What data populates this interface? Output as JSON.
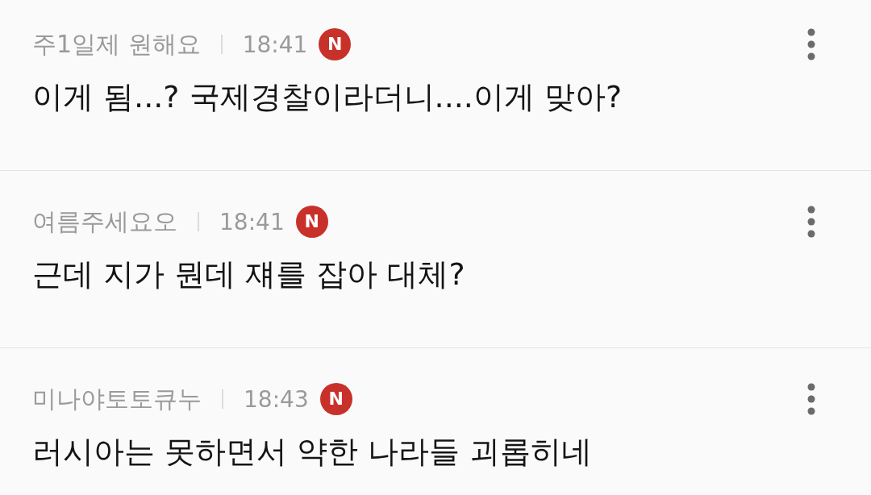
{
  "comments": [
    {
      "author": "주1일제 원해요",
      "time": "18:41",
      "badge": "N",
      "text": "이게 됨...? 국제경찰이라더니....이게 맞아?"
    },
    {
      "author": "여름주세요오",
      "time": "18:41",
      "badge": "N",
      "text": "근데 지가 뭔데 쟤를 잡아 대체?"
    },
    {
      "author": "미나야토토큐누",
      "time": "18:43",
      "badge": "N",
      "text": "러시아는 못하면서 약한 나라들 괴롭히네"
    }
  ]
}
